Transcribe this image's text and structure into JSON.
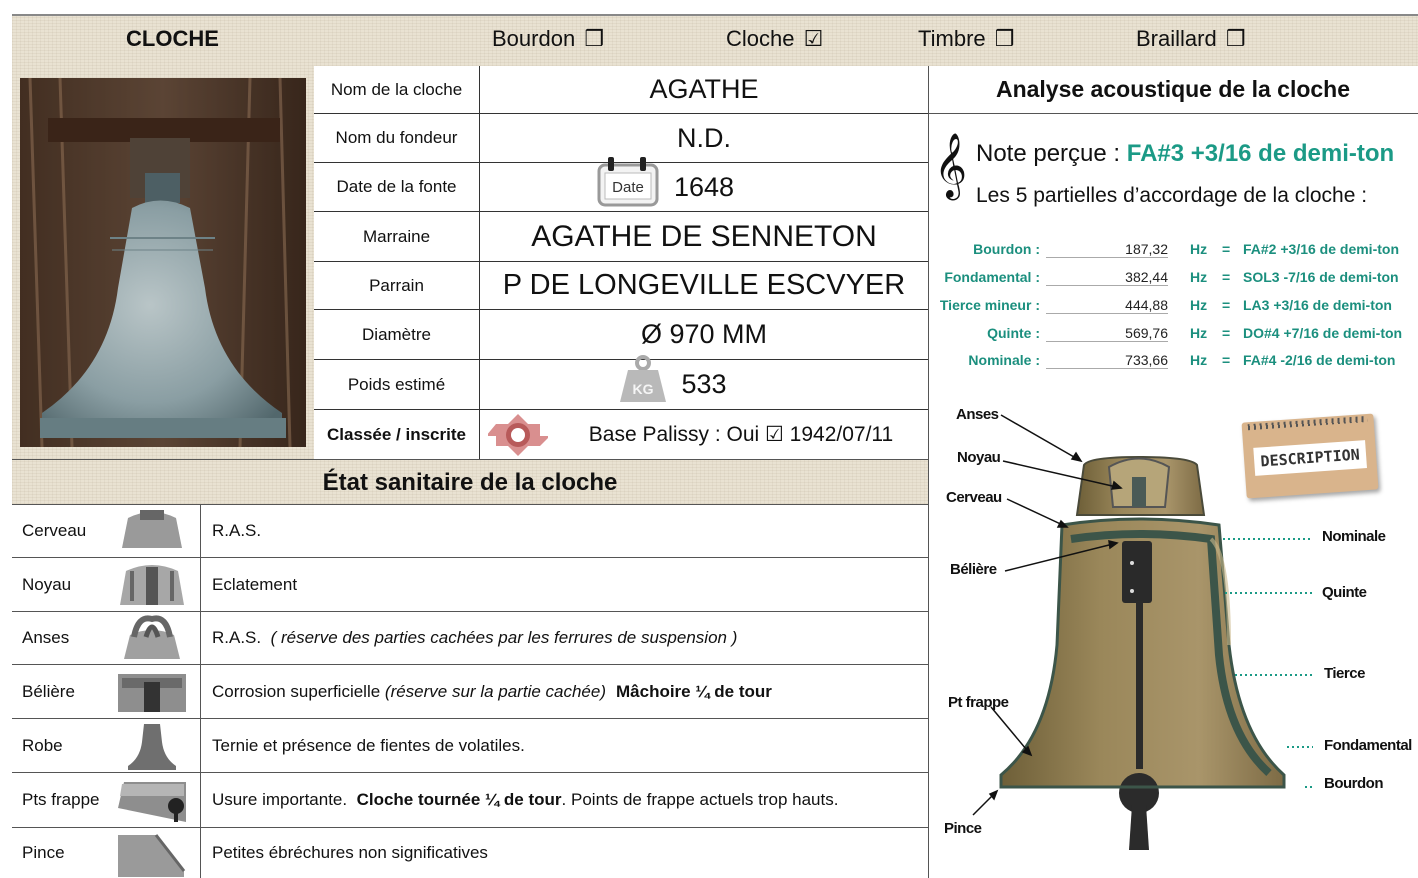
{
  "header": {
    "title": "CLOCHE",
    "types": [
      {
        "label": "Bourdon",
        "mark": "❒"
      },
      {
        "label": "Cloche",
        "mark": "☑"
      },
      {
        "label": "Timbre",
        "mark": "❒"
      },
      {
        "label": "Braillard",
        "mark": "❒"
      }
    ]
  },
  "info": {
    "rows": [
      {
        "label": "Nom de la cloche",
        "value": "AGATHE"
      },
      {
        "label": "Nom du fondeur",
        "value": "N.D."
      },
      {
        "label": "Date de la fonte",
        "value": "1648",
        "icon_text": "Date"
      },
      {
        "label": "Marraine",
        "value": "AGATHE DE SENNETON"
      },
      {
        "label": "Parrain",
        "value": "P DE LONGEVILLE ESCVYER"
      },
      {
        "label": "Diamètre",
        "value": "Ø 970 MM"
      },
      {
        "label": "Poids estimé",
        "value": "533",
        "icon_text": "KG"
      },
      {
        "label": "Classée / inscrite",
        "value": "Base Palissy :  Oui ☑  1942/07/11"
      }
    ]
  },
  "etat": {
    "title": "État sanitaire de la cloche",
    "rows": [
      {
        "name": "Cerveau",
        "desc": "R.A.S."
      },
      {
        "name": "Noyau",
        "desc": "Eclatement"
      },
      {
        "name": "Anses",
        "desc_plain": "R.A.S.  ",
        "desc_italic": "( réserve des parties cachées par les ferrures de suspension )"
      },
      {
        "name": "Bélière",
        "desc_plain": "Corrosion superficielle ",
        "desc_italic": "(réserve sur la partie cachée)",
        "desc_bold": "Mâchoire ¼ de tour"
      },
      {
        "name": "Robe",
        "desc": "Ternie et présence de fientes de volatiles."
      },
      {
        "name": "Pts frappe",
        "desc_plain": "Usure importante.  ",
        "desc_bold": "Cloche tournée ¼ de tour",
        "desc_tail": ". Points de frappe actuels trop hauts."
      },
      {
        "name": "Pince",
        "desc": "Petites ébréchures non significatives"
      }
    ]
  },
  "acoustique": {
    "title": "Analyse acoustique de la cloche",
    "note_label": "Note perçue : ",
    "note_value": "FA#3 +3/16 de demi-ton",
    "partials_title": "Les 5 partielles d’accordage de la cloche :",
    "partials": [
      {
        "name": "Bourdon :",
        "freq": "187,32",
        "unit": "Hz",
        "eq": "=",
        "note": "FA#2 +3/16 de demi-ton"
      },
      {
        "name": "Fondamental :",
        "freq": "382,44",
        "unit": "Hz",
        "eq": "=",
        "note": "SOL3 -7/16 de demi-ton"
      },
      {
        "name": "Tierce mineur :",
        "freq": "444,88",
        "unit": "Hz",
        "eq": "=",
        "note": "LA3 +3/16 de demi-ton"
      },
      {
        "name": "Quinte :",
        "freq": "569,76",
        "unit": "Hz",
        "eq": "=",
        "note": "DO#4 +7/16 de demi-ton"
      },
      {
        "name": "Nominale :",
        "freq": "733,66",
        "unit": "Hz",
        "eq": "=",
        "note": "FA#4 -2/16 de demi-ton"
      }
    ]
  },
  "diagram": {
    "left_labels": [
      "Anses",
      "Noyau",
      "Cerveau",
      "Bélière",
      "Pt frappe",
      "Pince"
    ],
    "right_labels": [
      "Nominale",
      "Quinte",
      "Tierce",
      "Fondamental",
      "Bourdon"
    ],
    "description_tag": "DESCRIPTION"
  },
  "colors": {
    "accent_teal": "#1b9a86",
    "linen": "#e9e2d2",
    "bell_bronze": "#8f7c4e",
    "bell_edge": "#3c5549"
  }
}
